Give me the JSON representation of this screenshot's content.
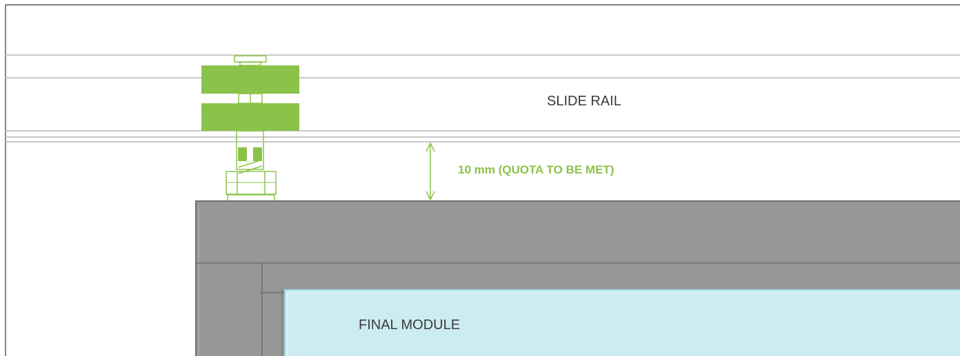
{
  "labels": {
    "slide_rail": "SLIDE RAIL",
    "dimension": "10 mm (QUOTA TO BE MET)",
    "final_module": "FINAL MODULE"
  },
  "colors": {
    "hanger_green": "#8bc34a",
    "frame_gray": "#979797",
    "frame_dark": "#6f6f6f",
    "glass_blue": "#cdecf2",
    "rail_line": "#c8c8c8",
    "outline": "#333333"
  }
}
